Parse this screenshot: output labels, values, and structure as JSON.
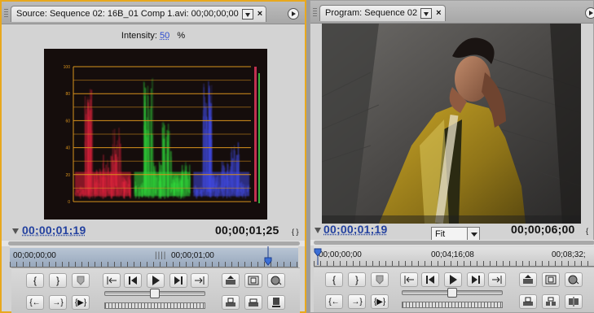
{
  "source": {
    "tab_title": "Source: Sequence 02: 16B_01 Comp 1.avi: 00;00;00;00",
    "intensity_label": "Intensity:",
    "intensity_value": "50",
    "intensity_unit": "%",
    "timecode_current": "00;00;01;19",
    "timecode_duration": "00;00;01;25",
    "ruler_start": "00;00;00;00",
    "ruler_mid": "00;00;01;00",
    "accent_color": "#e8a81e"
  },
  "program": {
    "tab_title": "Program: Sequence 02",
    "close_glyph": "×",
    "timecode_current": "00;00;01;19",
    "zoom_value": "Fit",
    "timecode_duration": "00;00;06;00",
    "ruler_start": "00;00;00;00",
    "ruler_mid": "00;04;16;08",
    "ruler_end": "00;08;32;"
  },
  "scope": {
    "axis_labels": [
      "100",
      "80",
      "60",
      "40",
      "20",
      "0"
    ],
    "channel_colors": [
      "#e0223c",
      "#2fd93a",
      "#3f49e0"
    ],
    "graticule_color": "#d8921c"
  },
  "icons": {
    "set_in": "set-in-point-icon",
    "set_out": "set-out-point-icon",
    "marker": "set-marker-icon",
    "goto_in": "go-to-in-point-icon",
    "step_back": "step-back-icon",
    "play": "play-icon",
    "step_forward": "step-forward-icon",
    "goto_out": "go-to-out-point-icon",
    "lift": "lift-icon",
    "extract": "extract-icon",
    "safe_margins": "safe-margins-icon",
    "output": "output-icon",
    "play_in_out": "play-in-to-out-icon",
    "insert": "insert-icon",
    "overlay": "overlay-icon",
    "export_frame": "export-frame-icon"
  }
}
